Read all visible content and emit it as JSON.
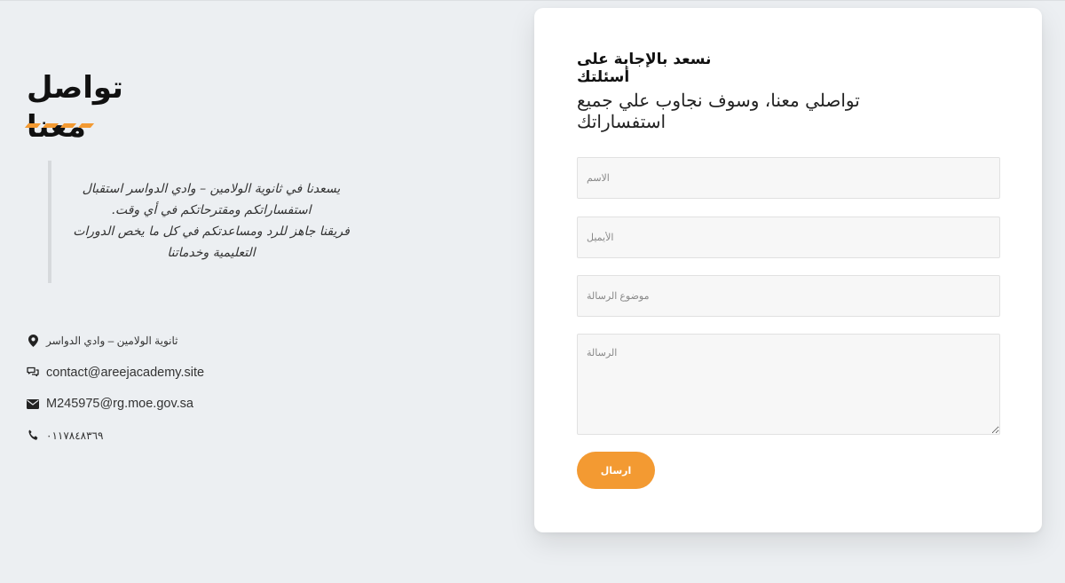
{
  "left": {
    "title": "تواصل معنا",
    "quote": "يسعدنا في ثانوية الولامين – وادي الدواسر استقبال استفساراتكم ومقترحاتكم في أي وقت.\nفريقنا جاهز للرد ومساعدتكم في كل ما يخص الدورات التعليمية وخدماتنا",
    "contacts": [
      {
        "icon": "location-pin-icon",
        "text": "ثانوية الولامين – وادي الدواسر"
      },
      {
        "icon": "chat-bubble-icon",
        "text": "contact@areejacademy.site"
      },
      {
        "icon": "envelope-icon",
        "text": "M245975@rg.moe.gov.sa"
      },
      {
        "icon": "phone-icon",
        "text": "٠١١٧٨٤٨٣٦٩"
      }
    ]
  },
  "accent_color": "#f39a32",
  "form": {
    "heading": "نسعد بالإجابة على أسئلتك",
    "subheading": "تواصلي معنا، وسوف نجاوب علي جميع استفساراتك",
    "name_placeholder": "الاسم",
    "email_placeholder": "الأيميل",
    "subject_placeholder": "موضوع الرسالة",
    "message_placeholder": "الرسالة",
    "submit_label": "ارسال"
  }
}
